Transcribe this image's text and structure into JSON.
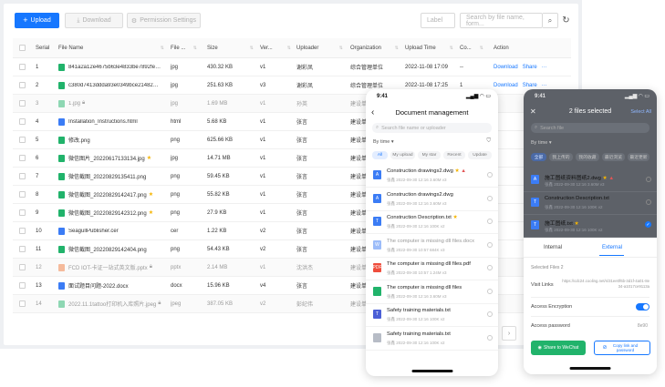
{
  "toolbar": {
    "upload_label": "Upload",
    "download_label": "Download",
    "permission_label": "Permission Settings",
    "label_placeholder": "Label",
    "search_placeholder": "Search by file name, form..."
  },
  "table": {
    "headers": [
      "Serial",
      "File Name",
      "File ...",
      "Size",
      "Ver...",
      "Uploader",
      "Organization",
      "Upload Time",
      "Co...",
      "Action"
    ],
    "rows": [
      {
        "serial": "1",
        "name": "841a2a12e4675b63e4833be7892febf.jpg",
        "type": "jpg",
        "size": "430.32 KB",
        "ver": "v1",
        "uploader": "谢彩凤",
        "org": "综合管理单位",
        "time": "2022-11-08 17:09",
        "co": "--",
        "star": false,
        "lock": false,
        "dim": false,
        "icon": "green",
        "actions": true
      },
      {
        "serial": "2",
        "name": "c380d7413ddda93e0349bce2148280.jpg",
        "type": "jpg",
        "size": "251.63 KB",
        "ver": "v3",
        "uploader": "谢彩凤",
        "org": "综合管理单位",
        "time": "2022-11-08 17:25",
        "co": "1",
        "star": false,
        "lock": false,
        "dim": false,
        "icon": "green",
        "actions": true
      },
      {
        "serial": "3",
        "name": "1.jpg",
        "type": "jpg",
        "size": "1.69 MB",
        "ver": "v1",
        "uploader": "孙英",
        "org": "建设单位",
        "time": "",
        "co": "",
        "star": false,
        "lock": true,
        "dim": true,
        "icon": "green",
        "actions": false
      },
      {
        "serial": "4",
        "name": "Installation_Instructions.html",
        "type": "html",
        "size": "5.68 KB",
        "ver": "v1",
        "uploader": "张言",
        "org": "建设单位",
        "time": "",
        "co": "",
        "star": false,
        "lock": false,
        "dim": false,
        "icon": "blue",
        "actions": false
      },
      {
        "serial": "5",
        "name": "修改.png",
        "type": "png",
        "size": "625.66 KB",
        "ver": "v1",
        "uploader": "张言",
        "org": "建设单位",
        "time": "",
        "co": "",
        "star": false,
        "lock": false,
        "dim": false,
        "icon": "green",
        "actions": false
      },
      {
        "serial": "6",
        "name": "微信图片_20220617133134.jpg",
        "type": "jpg",
        "size": "14.71 MB",
        "ver": "v1",
        "uploader": "张言",
        "org": "建设单位",
        "time": "",
        "co": "",
        "star": true,
        "lock": false,
        "dim": false,
        "icon": "green",
        "actions": false
      },
      {
        "serial": "7",
        "name": "微信截图_20220829135411.png",
        "type": "png",
        "size": "59.45 KB",
        "ver": "v1",
        "uploader": "张言",
        "org": "建设单位",
        "time": "",
        "co": "",
        "star": false,
        "lock": false,
        "dim": false,
        "icon": "green",
        "actions": false
      },
      {
        "serial": "8",
        "name": "微信截图_20220829142417.png",
        "type": "png",
        "size": "55.82 KB",
        "ver": "v1",
        "uploader": "张言",
        "org": "建设单位",
        "time": "",
        "co": "",
        "star": true,
        "lock": false,
        "dim": false,
        "icon": "green",
        "actions": false
      },
      {
        "serial": "9",
        "name": "微信截图_20220829142312.png",
        "type": "png",
        "size": "27.9 KB",
        "ver": "v1",
        "uploader": "张言",
        "org": "建设单位",
        "time": "",
        "co": "",
        "star": true,
        "lock": false,
        "dim": false,
        "icon": "green",
        "actions": false
      },
      {
        "serial": "10",
        "name": "SeagullPublisher.cer",
        "type": "cer",
        "size": "1.22 KB",
        "ver": "v2",
        "uploader": "张言",
        "org": "建设单位",
        "time": "",
        "co": "",
        "star": false,
        "lock": false,
        "dim": false,
        "icon": "blue",
        "actions": false
      },
      {
        "serial": "11",
        "name": "微信截图_20220829142404.png",
        "type": "png",
        "size": "54.43 KB",
        "ver": "v2",
        "uploader": "张言",
        "org": "建设单位",
        "time": "",
        "co": "",
        "star": false,
        "lock": false,
        "dim": false,
        "icon": "green",
        "actions": false
      },
      {
        "serial": "12",
        "name": "FCD IOT-卡证一站式英文版.pptx",
        "type": "pptx",
        "size": "2.14 MB",
        "ver": "v1",
        "uploader": "沈洪杰",
        "org": "建设单位",
        "time": "",
        "co": "",
        "star": false,
        "lock": true,
        "dim": true,
        "icon": "orange",
        "actions": false
      },
      {
        "serial": "13",
        "name": "面试题目问题-2022.docx",
        "type": "docx",
        "size": "15.96 KB",
        "ver": "v4",
        "uploader": "张言",
        "org": "建设单位",
        "time": "",
        "co": "",
        "star": false,
        "lock": false,
        "dim": false,
        "icon": "blue",
        "actions": false
      },
      {
        "serial": "14",
        "name": "2022.11.1tattoo打印机入库照片.jpeg",
        "type": "jpeg",
        "size": "387.05 KB",
        "ver": "v2",
        "uploader": "彭纪伟",
        "org": "建设单位",
        "time": "",
        "co": "",
        "star": false,
        "lock": true,
        "dim": true,
        "icon": "green",
        "actions": false
      }
    ],
    "action_download": "Download",
    "action_share": "Share",
    "action_more": "···"
  },
  "phone1": {
    "time": "9:41",
    "title": "Document management",
    "search_placeholder": "Search file name or uploader",
    "sort_label": "By time",
    "tabs": [
      "All",
      "My upload",
      "My star",
      "Recent",
      "Update"
    ],
    "files": [
      {
        "name": "Construction drawings2.dwg",
        "meta": "张鑫 2022-09-30 12:16  3.60M  v3",
        "icon": "blue",
        "letter": "A",
        "star": true,
        "warn": true,
        "dim": false
      },
      {
        "name": "Construction drawings2.dwg",
        "meta": "张鑫 2022-09-30 12:16  3.60M  v3",
        "icon": "blue",
        "letter": "A",
        "star": false,
        "warn": false,
        "dim": false
      },
      {
        "name": "Construction Description.txt",
        "meta": "张鑫 2022-09-30 12:16  100K  v2",
        "icon": "blue",
        "letter": "T",
        "star": true,
        "warn": false,
        "dim": false
      },
      {
        "name": "The computer is missing dll files.docx",
        "meta": "张鑫 2022-09-30 10:57  684K  v3",
        "icon": "blue",
        "letter": "W",
        "star": false,
        "warn": false,
        "dim": true
      },
      {
        "name": "The computer is missing dll files.pdf",
        "meta": "张鑫 2022-09-30 10:57  1.24M  v3",
        "icon": "red",
        "letter": "PDF",
        "star": false,
        "warn": false,
        "dim": false
      },
      {
        "name": "The computer is missing dll files",
        "meta": "张鑫 2022-09-30 12:16  3.60M  v3",
        "icon": "green",
        "letter": "",
        "star": false,
        "warn": false,
        "dim": false
      },
      {
        "name": "Safety training materials.txt",
        "meta": "张鑫 2022-09-30 12:16  100K  v2",
        "icon": "indigo",
        "letter": "T",
        "star": false,
        "warn": false,
        "dim": false
      },
      {
        "name": "Safety training materials.txt",
        "meta": "张鑫 2022-09-30 12:16  100K  v2",
        "icon": "gray",
        "letter": "",
        "star": false,
        "warn": false,
        "dim": false
      }
    ]
  },
  "phone2": {
    "time": "9:41",
    "title": "2 files selected",
    "select_all": "Select All",
    "search_placeholder": "Search file",
    "sort_label": "By time",
    "tabs": [
      "全部",
      "我上传的",
      "我的收藏",
      "最近浏览",
      "最近更新"
    ],
    "files": [
      {
        "name": "施工图纸资料图纸2.dwg",
        "meta": "张鑫 2022-09-30 12:16  3.60M  v3",
        "icon": "blue",
        "letter": "A",
        "star": true,
        "warn": true,
        "checked": false
      },
      {
        "name": "Construction Description.txt",
        "meta": "张鑫 2022-09-30 12:16  100K  v2",
        "icon": "blue",
        "letter": "T",
        "star": false,
        "warn": false,
        "checked": false
      },
      {
        "name": "施工图纸.txt",
        "meta": "张鑫 2022-09-30 12:16  100K  v2",
        "icon": "blue",
        "letter": "T",
        "star": true,
        "warn": false,
        "checked": true
      }
    ],
    "share_tabs": [
      "Internal",
      "External"
    ],
    "selected_files": "Selected Files 2",
    "visit_links_label": "Visit Links",
    "visit_links_value": "https://cdc24.cooling.net/s/31ee0f6b-3d1f-4a01-8e34-a1017ce9113a",
    "access_encryption_label": "Access Encryption",
    "access_password_label": "Access password",
    "access_password_value": "8e90",
    "wechat_label": "Share to WeChat",
    "copy_label": "Copy link and password"
  },
  "colors": {
    "primary": "#1677ff",
    "green": "#21b36b",
    "blue": "#3b7cf5",
    "orange": "#f07a3c",
    "red": "#ef4d3c",
    "star": "#f5b400"
  }
}
